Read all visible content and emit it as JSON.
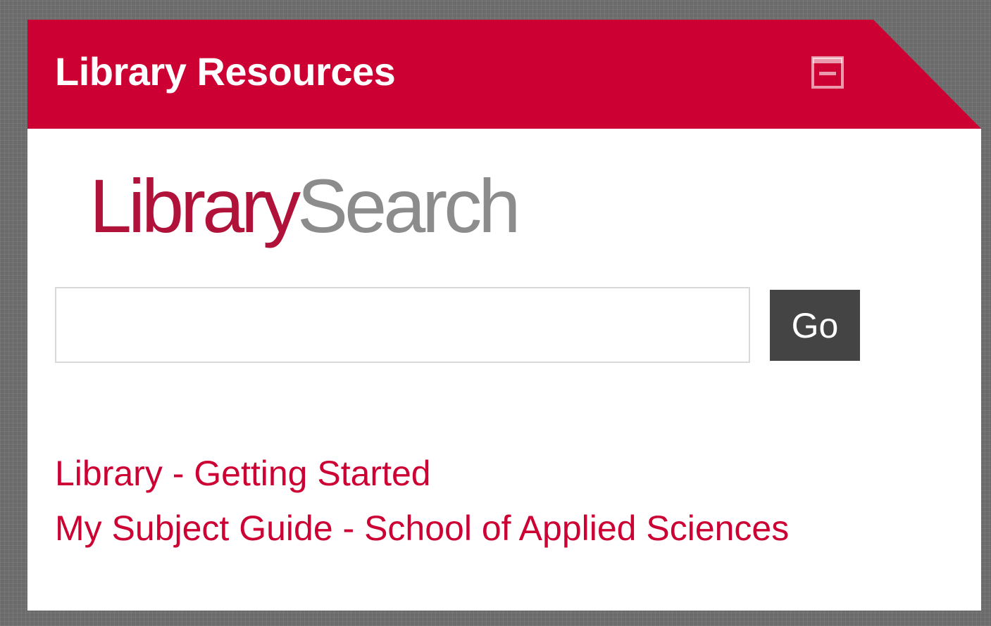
{
  "block": {
    "title": "Library Resources",
    "collapse_icon": "minimize-box-icon",
    "header_color": "#cc0033"
  },
  "logo": {
    "part1": "Library",
    "part2": "Search",
    "part1_color": "#b0123a",
    "part2_color": "#8c8c8c"
  },
  "search": {
    "value": "",
    "placeholder": "",
    "button_label": "Go"
  },
  "links": [
    {
      "label": "Library - Getting Started"
    },
    {
      "label": "My Subject Guide - School of Applied Sciences"
    }
  ],
  "colors": {
    "link": "#cc0033",
    "button": "#444444"
  }
}
